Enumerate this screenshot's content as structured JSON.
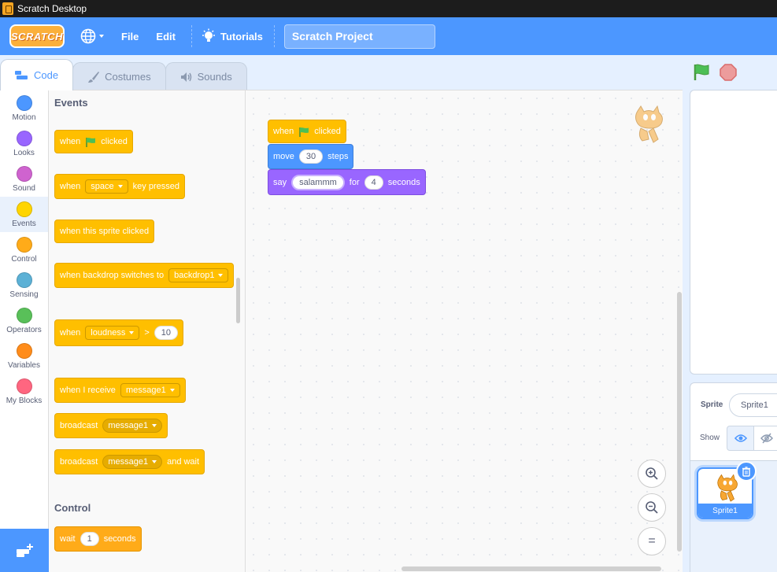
{
  "window": {
    "title": "Scratch Desktop"
  },
  "menu": {
    "logo": "SCRATCH",
    "file": "File",
    "edit": "Edit",
    "tutorials": "Tutorials",
    "project_title": "Scratch Project"
  },
  "tabs": [
    {
      "label": "Code",
      "icon": "code-icon",
      "active": true
    },
    {
      "label": "Costumes",
      "icon": "brush-icon",
      "active": false
    },
    {
      "label": "Sounds",
      "icon": "speaker-icon",
      "active": false
    }
  ],
  "categories": [
    {
      "label": "Motion",
      "color": "#4c97ff"
    },
    {
      "label": "Looks",
      "color": "#9966ff"
    },
    {
      "label": "Sound",
      "color": "#cf63cf"
    },
    {
      "label": "Events",
      "color": "#ffd500",
      "active": true
    },
    {
      "label": "Control",
      "color": "#ffab19"
    },
    {
      "label": "Sensing",
      "color": "#5cb1d6"
    },
    {
      "label": "Operators",
      "color": "#59c059"
    },
    {
      "label": "Variables",
      "color": "#ff8c1a"
    },
    {
      "label": "My Blocks",
      "color": "#ff6680"
    }
  ],
  "palette": {
    "events_heading": "Events",
    "control_heading": "Control",
    "b_flag": {
      "when": "when",
      "clicked": "clicked"
    },
    "b_key": {
      "when": "when",
      "key": "space",
      "pressed": "key pressed"
    },
    "b_sprite_clicked": "when this sprite clicked",
    "b_backdrop": {
      "text": "when backdrop switches to",
      "value": "backdrop1"
    },
    "b_loudness": {
      "when": "when",
      "value": "loudness",
      "op": ">",
      "num": "10"
    },
    "b_receive": {
      "text": "when I receive",
      "value": "message1"
    },
    "b_broadcast": {
      "text": "broadcast",
      "value": "message1"
    },
    "b_broadcast_wait": {
      "text": "broadcast",
      "value": "message1",
      "suffix": "and wait"
    },
    "b_wait": {
      "text": "wait",
      "num": "1",
      "suffix": "seconds"
    }
  },
  "script": {
    "hat": {
      "when": "when",
      "clicked": "clicked"
    },
    "move": {
      "text": "move",
      "num": "30",
      "suffix": "steps"
    },
    "say": {
      "text": "say",
      "message": "salammm",
      "for": "for",
      "num": "4",
      "suffix": "seconds"
    }
  },
  "zoom": {
    "reset": "="
  },
  "sprite_pane": {
    "sprite_label": "Sprite",
    "sprite_name": "Sprite1",
    "show_label": "Show",
    "tile_name": "Sprite1"
  },
  "colors": {
    "brand": "#4c97ff",
    "events": "#ffbf00",
    "looks": "#9966ff",
    "motion": "#4c97ff",
    "stop": "#ff6680",
    "flag": "#4cbf56"
  }
}
